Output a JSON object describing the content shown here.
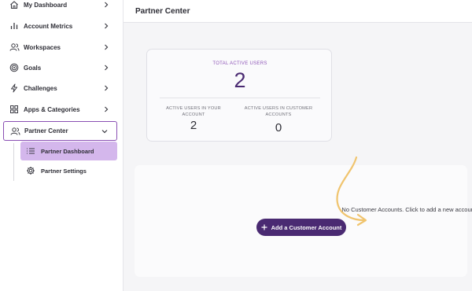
{
  "sidebar": {
    "items": [
      {
        "label": "My Dashboard",
        "icon": "home-icon"
      },
      {
        "label": "Account Metrics",
        "icon": "bar-chart-icon"
      },
      {
        "label": "Workspaces",
        "icon": "users-icon"
      },
      {
        "label": "Goals",
        "icon": "target-icon"
      },
      {
        "label": "Challenges",
        "icon": "lightning-icon"
      },
      {
        "label": "Apps & Categories",
        "icon": "grid-icon"
      },
      {
        "label": "Partner Center",
        "icon": "users-icon",
        "expanded": true
      }
    ],
    "sub_items": [
      {
        "label": "Partner Dashboard",
        "icon": "list-icon",
        "active": true
      },
      {
        "label": "Partner Settings",
        "icon": "gear-icon"
      }
    ]
  },
  "header": {
    "title": "Partner Center"
  },
  "stats": {
    "total_label": "TOTAL ACTIVE USERS",
    "total_value": "2",
    "your_account_label": "ACTIVE USERS IN YOUR ACCOUNT",
    "your_account_value": "2",
    "customer_label": "ACTIVE USERS IN CUSTOMER ACCOUNTS",
    "customer_value": "0"
  },
  "accounts": {
    "empty_message": "No Customer Accounts. Click to add a new account.",
    "add_button": "Add a Customer Account"
  },
  "colors": {
    "accent": "#4a2a72",
    "highlight": "#d4b7ec",
    "active_border": "#8a4fb3",
    "annotation_arrow": "#f0c46e"
  }
}
